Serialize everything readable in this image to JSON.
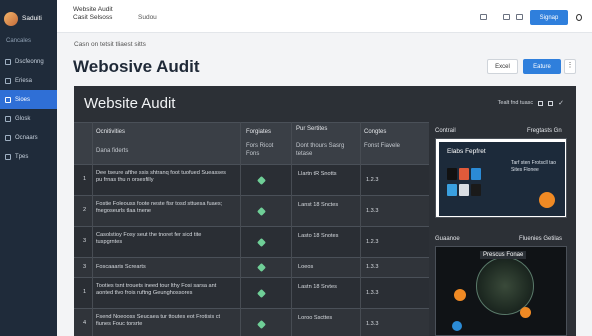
{
  "colors": {
    "sidebar": "#1f2b3a",
    "accent": "#2f7fdc",
    "panel": "#2c3036",
    "check": "#6fcf97",
    "orange": "#f08a24"
  },
  "brand": {
    "name": "Saduiti"
  },
  "sidebar": {
    "section": "Cancales",
    "items": [
      {
        "label": "Dscfeonng",
        "icon": "grid-icon",
        "active": false
      },
      {
        "label": "Eriesa",
        "icon": "folder-icon",
        "active": false
      },
      {
        "label": "Sioes",
        "icon": "page-icon",
        "active": true
      },
      {
        "label": "Glosk",
        "icon": "book-icon",
        "active": false
      },
      {
        "label": "Ocnaars",
        "icon": "chart-icon",
        "active": false
      },
      {
        "label": "Tpes",
        "icon": "list-icon",
        "active": false
      }
    ]
  },
  "topbar": {
    "line1": "Website Audit",
    "line2": "Casit Selsoss",
    "context": "Sudou",
    "signin": "Signap"
  },
  "breadcrumb": "Casn on tetsit tliaest sitts",
  "page_title": "Webosive Audit",
  "actions": {
    "excel": "Excel",
    "primary": "Eature",
    "more": "⋮"
  },
  "panel": {
    "title": "Website Audit",
    "tools_label": "Tealt fnd tuasc"
  },
  "table": {
    "headers": {
      "col1_top": "Ocnitivities",
      "col1_sub": "Dana fiderts",
      "col2_top": "Forgiates",
      "col2_sub": "Fors Ricot Fons",
      "col3_top": "Pur Sertites",
      "col3_sub": "Dont thours Sasrg tetase",
      "col4_top": "Congtes",
      "col4_sub": "Fonst Fiavele"
    },
    "rows": [
      {
        "num": "1",
        "desc": "Dee tseure afthe ssis shtranq foot tuofued Sueasses pu frnas thu n orsesfilly",
        "spec": "Llartn tR Snotts",
        "score": "1.2.3"
      },
      {
        "num": "2",
        "desc": "Fostie Foleouss foote neste fisr tosd sttuesa fuaes; fnegoseurls tlaa tnene",
        "spec": "Lanst 18 Snctes",
        "score": "1.3.3"
      },
      {
        "num": "3",
        "desc": "Casolstioy Fosy seut the tnoret fer sicd tite tuspgrntes",
        "spec": "Lasto 18 Snotes",
        "score": "1.2.3"
      },
      {
        "num": "3",
        "desc": "Foscaaaris Screarts",
        "spec": "Loeos",
        "score": "1.3.3"
      },
      {
        "num": "1",
        "desc": "Tooties tsnt trouets ineed tour lthy Fosi sarsa ant aonted tlvo frois ruftng Geunghossores",
        "spec": "Lastn 18 Srvtes",
        "score": "1.3.3"
      },
      {
        "num": "4",
        "desc": "Fsend Noeooss Seucaea tur ttoutes eot Frotisis ct fiunes Fouc torsrte",
        "spec": "Loroo Sscttes",
        "score": "1.3.3"
      }
    ]
  },
  "side": {
    "head1_left": "Contrail",
    "head1_right": "Fregtasts Gn",
    "card1_title": "Elabs Fepfret",
    "card1_sub": "Tarf sten Frotscll tao Sites Flonee",
    "head2_left": "Guaanoe",
    "head2_right": "Fluenies Getilas",
    "card2_banner": "Prescus Fonae"
  }
}
